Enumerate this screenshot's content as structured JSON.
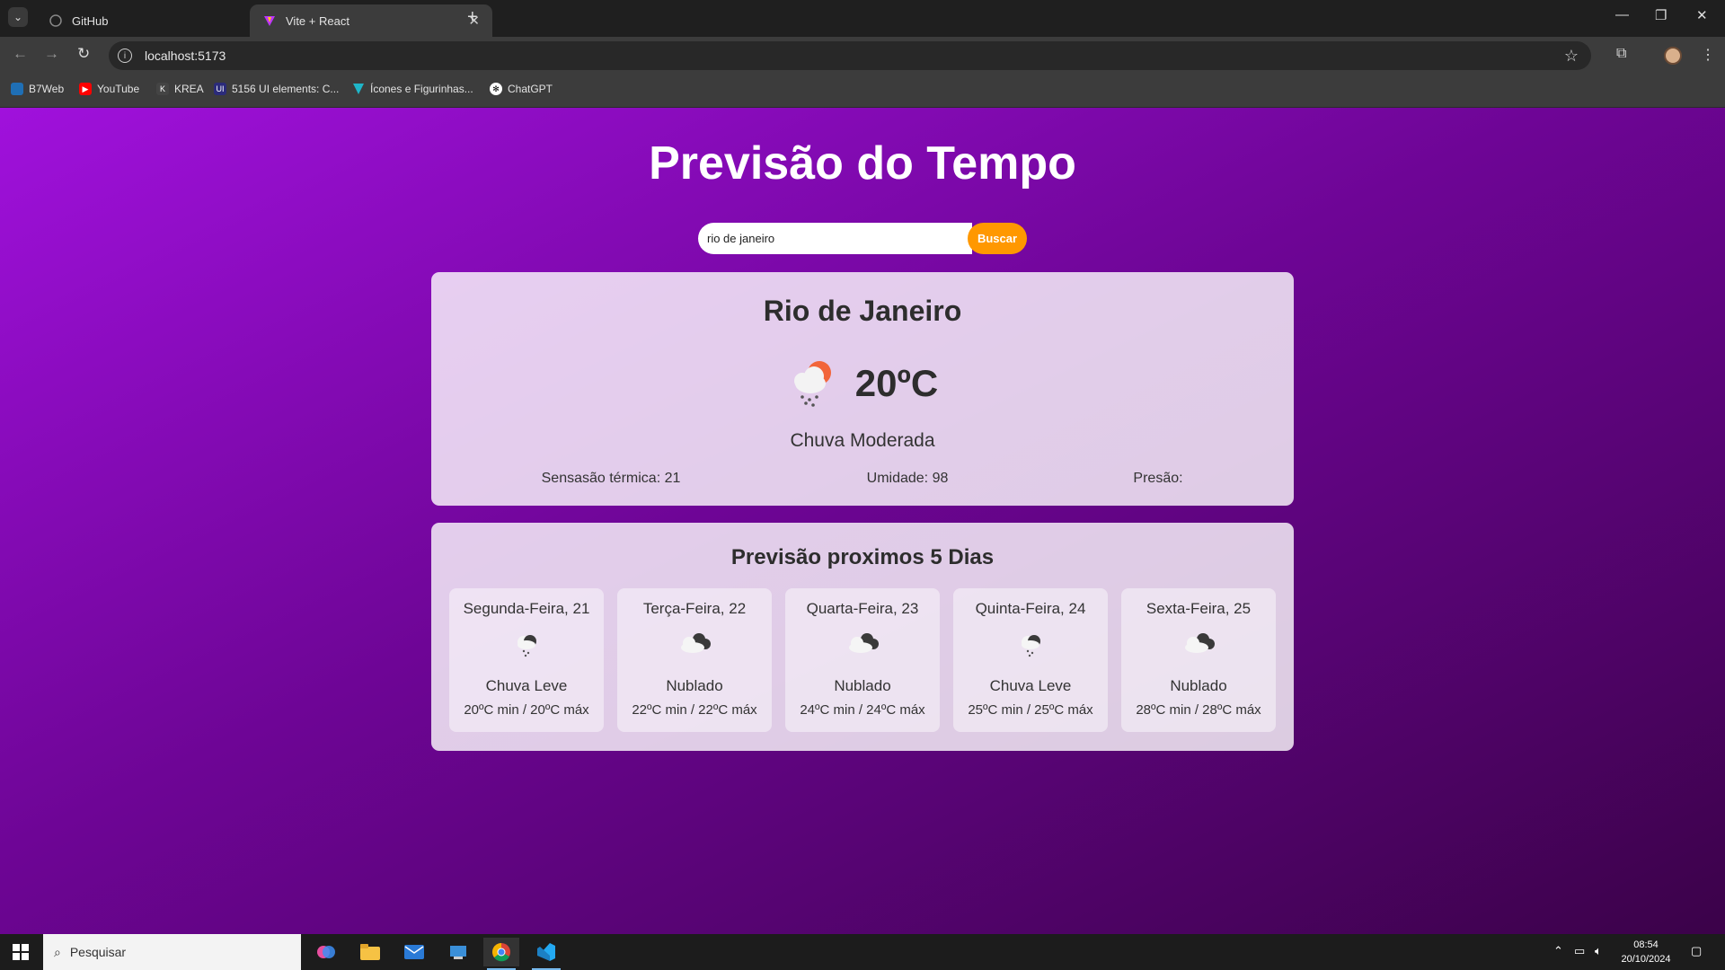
{
  "browser": {
    "tabs": [
      {
        "title": "GitHub",
        "active": false
      },
      {
        "title": "Vite + React",
        "active": true
      }
    ],
    "url": "localhost:5173",
    "bookmarks": [
      "B7Web",
      "YouTube",
      "KREA",
      "5156 UI elements: C...",
      "Ícones e Figurinhas...",
      "ChatGPT"
    ]
  },
  "app": {
    "title": "Previsão do Tempo",
    "search": {
      "value": "rio de janeiro",
      "button": "Buscar"
    },
    "current": {
      "city": "Rio de Janeiro",
      "temperature": "20ºC",
      "condition": "Chuva Moderada",
      "feels_like": "Sensasão térmica: 21",
      "humidity": "Umidade: 98",
      "pressure": "Presão:"
    },
    "forecast": {
      "title": "Previsão proximos 5 Dias",
      "days": [
        {
          "day": "Segunda-Feira, 21",
          "desc": "Chuva Leve",
          "range": "20ºC min / 20ºC máx",
          "icon": "light-rain-icon"
        },
        {
          "day": "Terça-Feira, 22",
          "desc": "Nublado",
          "range": "22ºC min / 22ºC máx",
          "icon": "cloudy-icon"
        },
        {
          "day": "Quarta-Feira, 23",
          "desc": "Nublado",
          "range": "24ºC min / 24ºC máx",
          "icon": "cloudy-icon"
        },
        {
          "day": "Quinta-Feira, 24",
          "desc": "Chuva Leve",
          "range": "25ºC min / 25ºC máx",
          "icon": "light-rain-icon"
        },
        {
          "day": "Sexta-Feira, 25",
          "desc": "Nublado",
          "range": "28ºC min / 28ºC máx",
          "icon": "cloudy-icon"
        }
      ]
    }
  },
  "taskbar": {
    "search_placeholder": "Pesquisar",
    "time": "08:54",
    "date": "20/10/2024"
  },
  "colors": {
    "accent": "#ff9800",
    "gradient_start": "#a011dc",
    "gradient_end": "#3b0249"
  }
}
